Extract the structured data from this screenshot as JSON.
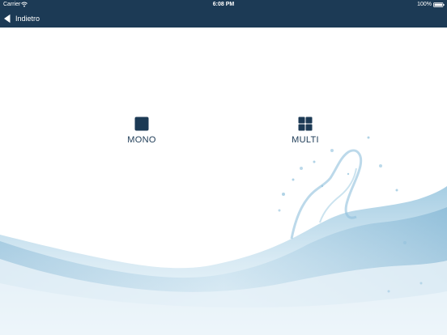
{
  "status_bar": {
    "carrier": "Carrier",
    "time": "6:08 PM",
    "battery": "100%"
  },
  "nav_bar": {
    "back_label": "Indietro"
  },
  "modes": {
    "mono_label": "MONO",
    "multi_label": "MULTI"
  },
  "colors": {
    "nav_background": "#1c3a55",
    "accent": "#1c3a55",
    "water": "#7fb6d6"
  },
  "icons": {
    "mono": "single-square-icon",
    "multi": "four-squares-grid-icon",
    "back": "back-arrow-icon"
  }
}
